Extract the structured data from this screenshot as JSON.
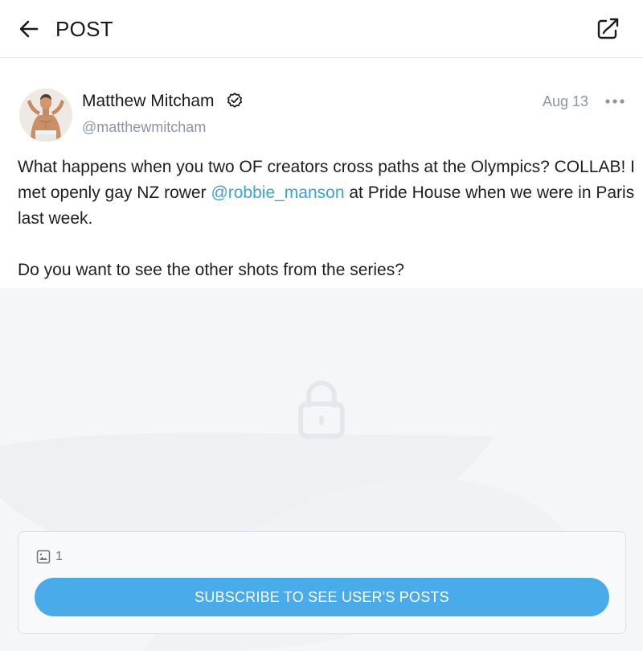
{
  "header": {
    "title": "POST",
    "back_icon": "arrow-left-icon",
    "share_icon": "share-icon"
  },
  "post": {
    "author": {
      "name": "Matthew Mitcham",
      "handle": "@matthewmitcham",
      "verified_icon": "verified-badge-icon"
    },
    "date": "Aug 13",
    "more_icon": "more-dots-icon",
    "text": {
      "line1_pre": "What happens when you two OF creators cross paths at the Olympics? COLLAB! I met openly gay NZ rower ",
      "mention": "@robbie_manson",
      "line1_post": " at Pride House when we were in Paris last week.",
      "line2": "Do you want to see the other shots from the series?"
    }
  },
  "locked": {
    "lock_icon": "lock-icon",
    "media_icon": "image-icon",
    "media_count": "1",
    "subscribe_label": "SUBSCRIBE TO SEE USER'S POSTS"
  },
  "colors": {
    "accent": "#4aabea",
    "mention": "#3aa3d8",
    "muted_text": "#8a96a3",
    "locked_bg": "#f5f6f8"
  }
}
